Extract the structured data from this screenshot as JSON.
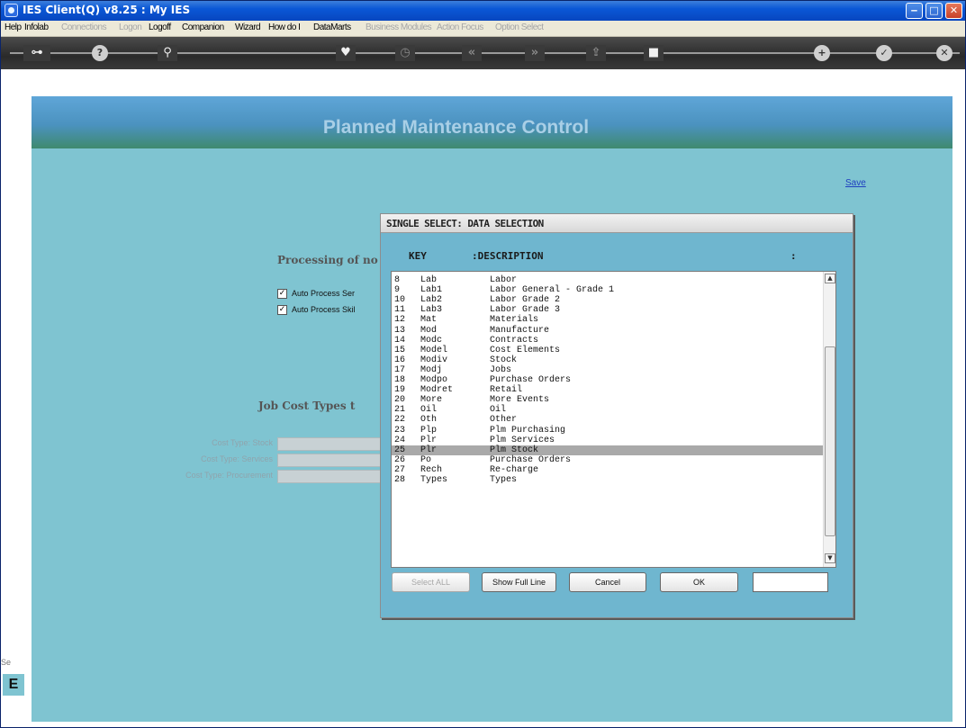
{
  "window": {
    "title": "IES Client(Q) v8.25 : My IES",
    "controls": {
      "minimize": "‒",
      "maximize": "□",
      "close": "✕"
    }
  },
  "menu": {
    "items": [
      {
        "label": "Help",
        "enabled": true
      },
      {
        "label": "Infolab",
        "enabled": true
      },
      {
        "label": "Connections",
        "enabled": false
      },
      {
        "label": "Logon",
        "enabled": false
      },
      {
        "label": "Logoff",
        "enabled": true
      },
      {
        "label": "Companion",
        "enabled": true
      },
      {
        "label": "Wizard",
        "enabled": true
      },
      {
        "label": "How do I",
        "enabled": true
      },
      {
        "label": "DataMarts",
        "enabled": true
      },
      {
        "label": "Business Modules",
        "enabled": false
      },
      {
        "label": "Action Focus",
        "enabled": false
      },
      {
        "label": "Option Select",
        "enabled": false
      }
    ]
  },
  "toolbar": {
    "icons": [
      "key-icon",
      "help-icon",
      "search-icon",
      "heart-icon",
      "clock-icon",
      "rewind-icon",
      "fast-forward-icon",
      "export-icon",
      "stop-icon",
      "plus-icon",
      "check-icon",
      "close-icon"
    ]
  },
  "page": {
    "title": "Planned Maintenance Control",
    "save_label": "Save",
    "processing_heading": "Processing of no",
    "checkboxes": [
      {
        "label": "Auto Process Ser",
        "checked": true
      },
      {
        "label": "Auto Process Skil",
        "checked": true
      }
    ],
    "jobcost_heading": "Job Cost Types t",
    "cost_types": [
      {
        "label": "Cost Type: Stock",
        "value": ""
      },
      {
        "label": "Cost Type: Services",
        "value": ""
      },
      {
        "label": "Cost Type: Procurement",
        "value": ""
      }
    ],
    "side_text": "Se",
    "side_icon": "E"
  },
  "dialog": {
    "title": "SINGLE SELECT: DATA SELECTION",
    "col_key": "KEY",
    "col_desc": ":DESCRIPTION",
    "col_end": ":",
    "rows": [
      {
        "num": "8",
        "key": "Lab",
        "desc": "Labor",
        "selected": false
      },
      {
        "num": "9",
        "key": "Lab1",
        "desc": "Labor General - Grade 1",
        "selected": false
      },
      {
        "num": "10",
        "key": "Lab2",
        "desc": "Labor Grade 2",
        "selected": false
      },
      {
        "num": "11",
        "key": "Lab3",
        "desc": "Labor Grade 3",
        "selected": false
      },
      {
        "num": "12",
        "key": "Mat",
        "desc": "Materials",
        "selected": false
      },
      {
        "num": "13",
        "key": "Mod",
        "desc": "Manufacture",
        "selected": false
      },
      {
        "num": "14",
        "key": "Modc",
        "desc": "Contracts",
        "selected": false
      },
      {
        "num": "15",
        "key": "Model",
        "desc": "Cost Elements",
        "selected": false
      },
      {
        "num": "16",
        "key": "Modiv",
        "desc": "Stock",
        "selected": false
      },
      {
        "num": "17",
        "key": "Modj",
        "desc": "Jobs",
        "selected": false
      },
      {
        "num": "18",
        "key": "Modpo",
        "desc": "Purchase Orders",
        "selected": false
      },
      {
        "num": "19",
        "key": "Modret",
        "desc": "Retail",
        "selected": false
      },
      {
        "num": "20",
        "key": "More",
        "desc": "More Events",
        "selected": false
      },
      {
        "num": "21",
        "key": "Oil",
        "desc": "Oil",
        "selected": false
      },
      {
        "num": "22",
        "key": "Oth",
        "desc": "Other",
        "selected": false
      },
      {
        "num": "23",
        "key": "Plp",
        "desc": "Plm Purchasing",
        "selected": false
      },
      {
        "num": "24",
        "key": "Plr",
        "desc": "Plm Services",
        "selected": false
      },
      {
        "num": "25",
        "key": "Plr",
        "desc": "Plm Stock",
        "selected": true
      },
      {
        "num": "26",
        "key": "Po",
        "desc": "Purchase Orders",
        "selected": false
      },
      {
        "num": "27",
        "key": "Rech",
        "desc": "Re-charge",
        "selected": false
      },
      {
        "num": "28",
        "key": "Types",
        "desc": "Types",
        "selected": false
      }
    ],
    "buttons": {
      "select_all": "Select ALL",
      "show_full_line": "Show Full Line",
      "cancel": "Cancel",
      "ok": "OK"
    },
    "input_value": ""
  }
}
